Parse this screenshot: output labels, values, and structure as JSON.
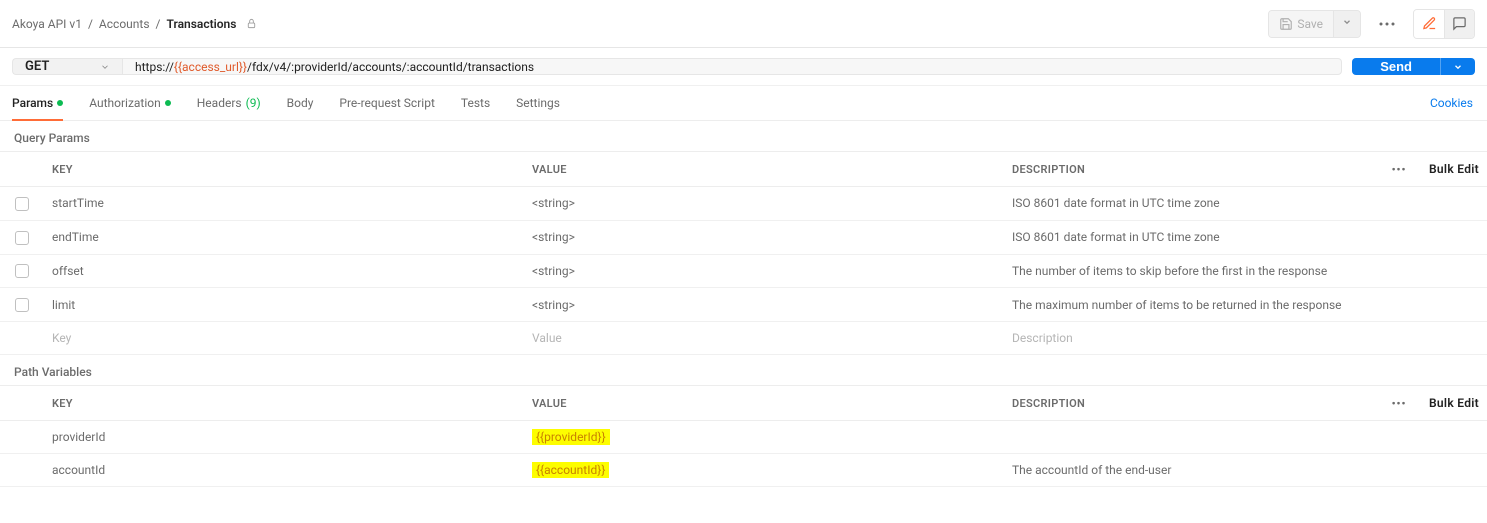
{
  "breadcrumbs": {
    "a": "Akoya API v1",
    "b": "Accounts",
    "c": "Transactions"
  },
  "topbar": {
    "save": "Save"
  },
  "request": {
    "method": "GET",
    "url_prefix": "https://",
    "url_var": "{{access_url}}",
    "url_suffix": "/fdx/v4/:providerId/accounts/:accountId/transactions",
    "send": "Send"
  },
  "tabs": {
    "params": "Params",
    "authorization": "Authorization",
    "headers_label": "Headers",
    "headers_count": "(9)",
    "body": "Body",
    "prerequest": "Pre-request Script",
    "tests": "Tests",
    "settings": "Settings",
    "cookies": "Cookies"
  },
  "sections": {
    "query": "Query Params",
    "path": "Path Variables"
  },
  "headers": {
    "key": "KEY",
    "value": "VALUE",
    "description": "DESCRIPTION",
    "bulk": "Bulk Edit"
  },
  "placeholders": {
    "key": "Key",
    "value": "Value",
    "description": "Description"
  },
  "query_rows": [
    {
      "key": "startTime",
      "value": "<string>",
      "desc": "ISO 8601 date format in UTC time zone"
    },
    {
      "key": "endTime",
      "value": "<string>",
      "desc": "ISO 8601 date format in UTC time zone"
    },
    {
      "key": "offset",
      "value": "<string>",
      "desc": "The number of items to skip before the first in the response"
    },
    {
      "key": "limit",
      "value": "<string>",
      "desc": "The maximum number of items to be returned in the response"
    }
  ],
  "path_rows": [
    {
      "key": "providerId",
      "value": "{{providerId}}",
      "desc": "",
      "highlight": true
    },
    {
      "key": "accountId",
      "value": "{{accountId}}",
      "desc": "The accountId of the end-user",
      "highlight": true
    }
  ]
}
